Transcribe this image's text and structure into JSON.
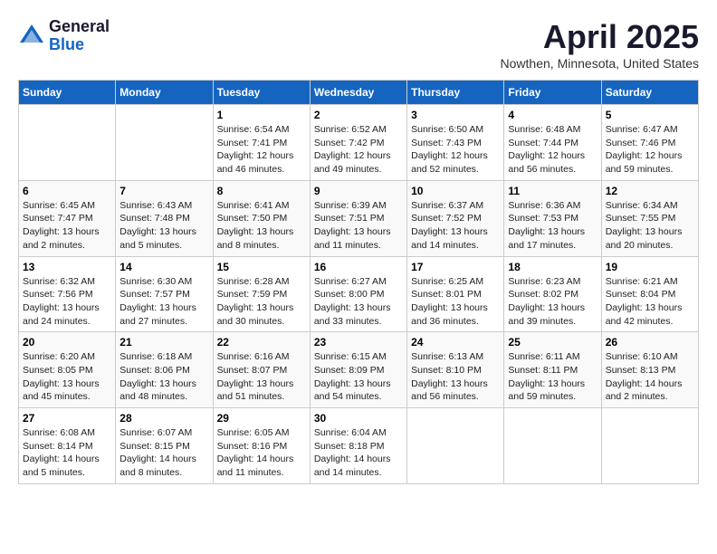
{
  "logo": {
    "general": "General",
    "blue": "Blue"
  },
  "title": "April 2025",
  "location": "Nowthen, Minnesota, United States",
  "days_of_week": [
    "Sunday",
    "Monday",
    "Tuesday",
    "Wednesday",
    "Thursday",
    "Friday",
    "Saturday"
  ],
  "weeks": [
    [
      {
        "day": "",
        "info": ""
      },
      {
        "day": "",
        "info": ""
      },
      {
        "day": "1",
        "info": "Sunrise: 6:54 AM\nSunset: 7:41 PM\nDaylight: 12 hours and 46 minutes."
      },
      {
        "day": "2",
        "info": "Sunrise: 6:52 AM\nSunset: 7:42 PM\nDaylight: 12 hours and 49 minutes."
      },
      {
        "day": "3",
        "info": "Sunrise: 6:50 AM\nSunset: 7:43 PM\nDaylight: 12 hours and 52 minutes."
      },
      {
        "day": "4",
        "info": "Sunrise: 6:48 AM\nSunset: 7:44 PM\nDaylight: 12 hours and 56 minutes."
      },
      {
        "day": "5",
        "info": "Sunrise: 6:47 AM\nSunset: 7:46 PM\nDaylight: 12 hours and 59 minutes."
      }
    ],
    [
      {
        "day": "6",
        "info": "Sunrise: 6:45 AM\nSunset: 7:47 PM\nDaylight: 13 hours and 2 minutes."
      },
      {
        "day": "7",
        "info": "Sunrise: 6:43 AM\nSunset: 7:48 PM\nDaylight: 13 hours and 5 minutes."
      },
      {
        "day": "8",
        "info": "Sunrise: 6:41 AM\nSunset: 7:50 PM\nDaylight: 13 hours and 8 minutes."
      },
      {
        "day": "9",
        "info": "Sunrise: 6:39 AM\nSunset: 7:51 PM\nDaylight: 13 hours and 11 minutes."
      },
      {
        "day": "10",
        "info": "Sunrise: 6:37 AM\nSunset: 7:52 PM\nDaylight: 13 hours and 14 minutes."
      },
      {
        "day": "11",
        "info": "Sunrise: 6:36 AM\nSunset: 7:53 PM\nDaylight: 13 hours and 17 minutes."
      },
      {
        "day": "12",
        "info": "Sunrise: 6:34 AM\nSunset: 7:55 PM\nDaylight: 13 hours and 20 minutes."
      }
    ],
    [
      {
        "day": "13",
        "info": "Sunrise: 6:32 AM\nSunset: 7:56 PM\nDaylight: 13 hours and 24 minutes."
      },
      {
        "day": "14",
        "info": "Sunrise: 6:30 AM\nSunset: 7:57 PM\nDaylight: 13 hours and 27 minutes."
      },
      {
        "day": "15",
        "info": "Sunrise: 6:28 AM\nSunset: 7:59 PM\nDaylight: 13 hours and 30 minutes."
      },
      {
        "day": "16",
        "info": "Sunrise: 6:27 AM\nSunset: 8:00 PM\nDaylight: 13 hours and 33 minutes."
      },
      {
        "day": "17",
        "info": "Sunrise: 6:25 AM\nSunset: 8:01 PM\nDaylight: 13 hours and 36 minutes."
      },
      {
        "day": "18",
        "info": "Sunrise: 6:23 AM\nSunset: 8:02 PM\nDaylight: 13 hours and 39 minutes."
      },
      {
        "day": "19",
        "info": "Sunrise: 6:21 AM\nSunset: 8:04 PM\nDaylight: 13 hours and 42 minutes."
      }
    ],
    [
      {
        "day": "20",
        "info": "Sunrise: 6:20 AM\nSunset: 8:05 PM\nDaylight: 13 hours and 45 minutes."
      },
      {
        "day": "21",
        "info": "Sunrise: 6:18 AM\nSunset: 8:06 PM\nDaylight: 13 hours and 48 minutes."
      },
      {
        "day": "22",
        "info": "Sunrise: 6:16 AM\nSunset: 8:07 PM\nDaylight: 13 hours and 51 minutes."
      },
      {
        "day": "23",
        "info": "Sunrise: 6:15 AM\nSunset: 8:09 PM\nDaylight: 13 hours and 54 minutes."
      },
      {
        "day": "24",
        "info": "Sunrise: 6:13 AM\nSunset: 8:10 PM\nDaylight: 13 hours and 56 minutes."
      },
      {
        "day": "25",
        "info": "Sunrise: 6:11 AM\nSunset: 8:11 PM\nDaylight: 13 hours and 59 minutes."
      },
      {
        "day": "26",
        "info": "Sunrise: 6:10 AM\nSunset: 8:13 PM\nDaylight: 14 hours and 2 minutes."
      }
    ],
    [
      {
        "day": "27",
        "info": "Sunrise: 6:08 AM\nSunset: 8:14 PM\nDaylight: 14 hours and 5 minutes."
      },
      {
        "day": "28",
        "info": "Sunrise: 6:07 AM\nSunset: 8:15 PM\nDaylight: 14 hours and 8 minutes."
      },
      {
        "day": "29",
        "info": "Sunrise: 6:05 AM\nSunset: 8:16 PM\nDaylight: 14 hours and 11 minutes."
      },
      {
        "day": "30",
        "info": "Sunrise: 6:04 AM\nSunset: 8:18 PM\nDaylight: 14 hours and 14 minutes."
      },
      {
        "day": "",
        "info": ""
      },
      {
        "day": "",
        "info": ""
      },
      {
        "day": "",
        "info": ""
      }
    ]
  ]
}
